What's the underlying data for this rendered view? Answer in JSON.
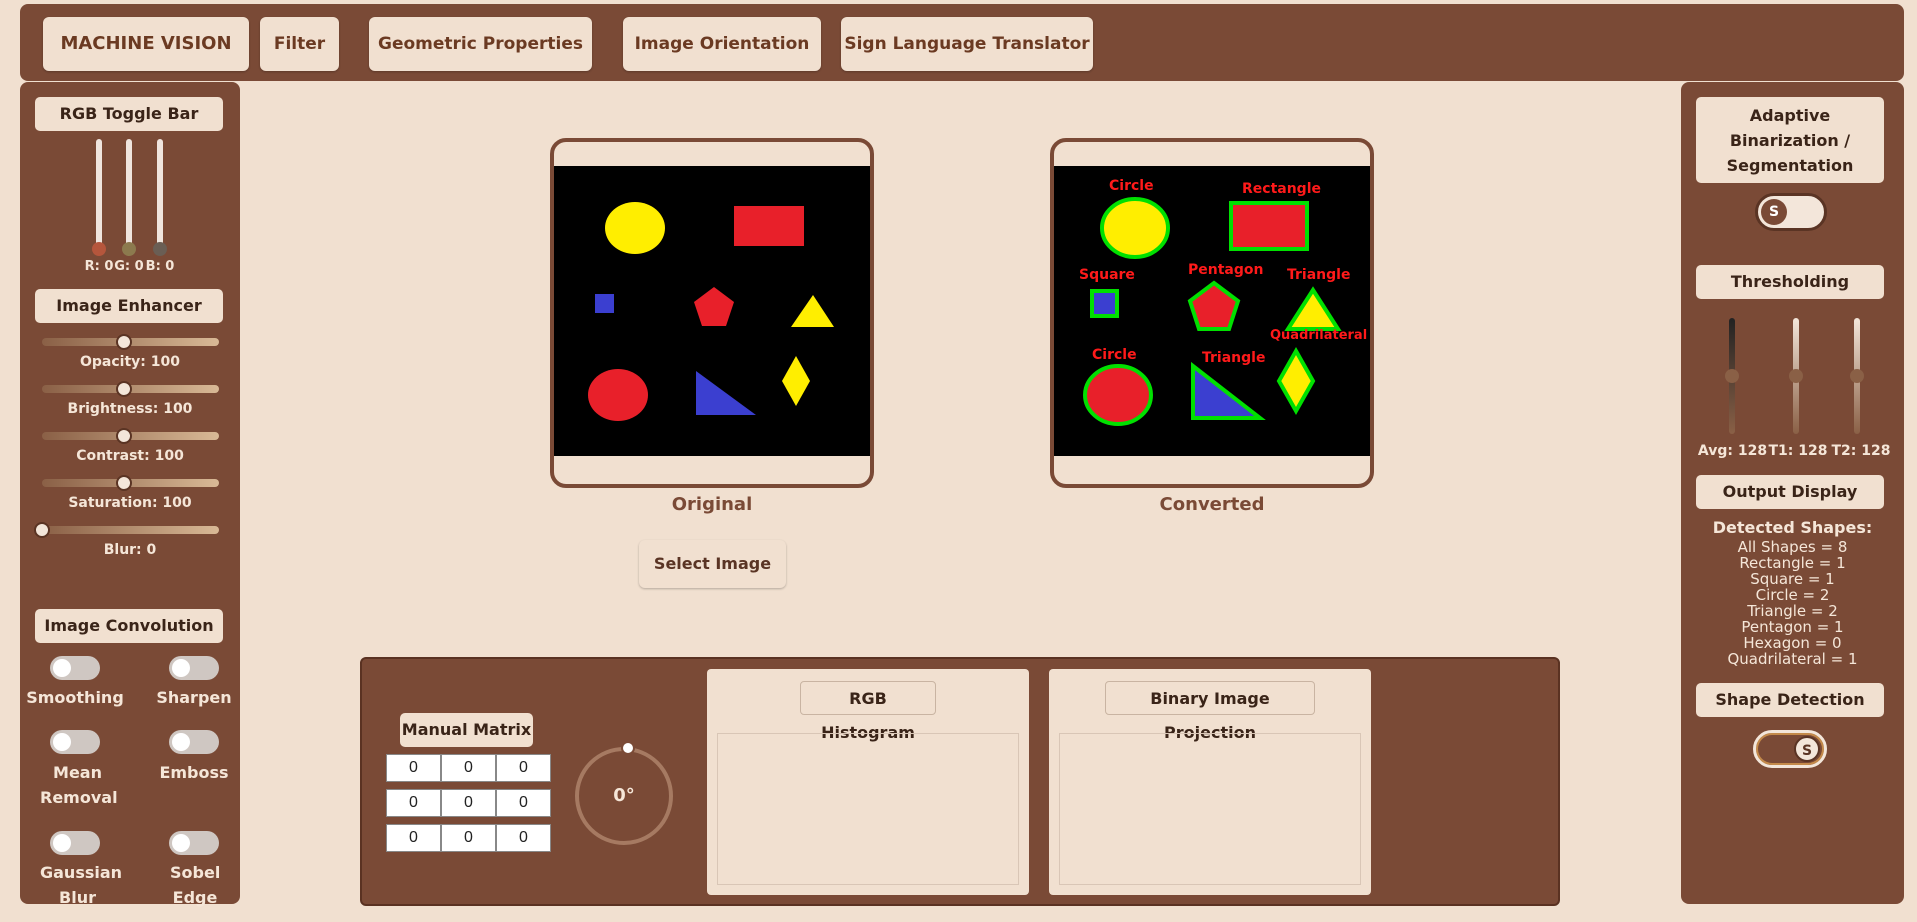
{
  "nav": {
    "brand": "MACHINE VISION",
    "items": [
      "Filter",
      "Geometric Properties",
      "Image Orientation",
      "Sign Language Translator"
    ]
  },
  "left": {
    "rgb_title": "RGB Toggle Bar",
    "rgb_values": {
      "r": "R: 0",
      "g": "G: 0",
      "b": "B: 0"
    },
    "rgb_colors": {
      "r": "#b5563c",
      "g": "#8c7a4e",
      "b": "#6a5e54"
    },
    "enhancer_title": "Image Enhancer",
    "enhancer": [
      {
        "label": "Opacity: 100",
        "value": 0.5
      },
      {
        "label": "Brightness: 100",
        "value": 0.5
      },
      {
        "label": "Contrast: 100",
        "value": 0.5
      },
      {
        "label": "Saturation: 100",
        "value": 0.5
      },
      {
        "label": "Blur: 0",
        "value": 0.0
      }
    ],
    "convolution_title": "Image Convolution",
    "filters": [
      {
        "label": "Smoothing"
      },
      {
        "label": "Sharpen"
      },
      {
        "label": "Mean Removal"
      },
      {
        "label": "Emboss"
      },
      {
        "label": "Gaussian Blur"
      },
      {
        "label": "Sobel Edge"
      }
    ]
  },
  "main": {
    "original_caption": "Original",
    "converted_caption": "Converted",
    "select_button": "Select Image",
    "shape_labels": [
      "Circle",
      "Rectangle",
      "Square",
      "Pentagon",
      "Triangle",
      "Quadrilateral",
      "Circle",
      "Triangle"
    ]
  },
  "bottom": {
    "matrix_title": "Manual Matrix",
    "matrix": [
      [
        "0",
        "0",
        "0"
      ],
      [
        "0",
        "0",
        "0"
      ],
      [
        "0",
        "0",
        "0"
      ]
    ],
    "rotation": "0°",
    "histogram_title": "RGB Histogram",
    "projection_title": "Binary Image Projection"
  },
  "right": {
    "adaptive_title": "Adaptive Binarization / Segmentation",
    "adaptive_toggle": "S",
    "threshold_title": "Thresholding",
    "thresholds": {
      "avg": "Avg: 128",
      "t1": "T1: 128",
      "t2": "T2: 128"
    },
    "output_title": "Output Display",
    "detected_heading": "Detected Shapes:",
    "detected": [
      "All Shapes = 8",
      "Rectangle = 1",
      "Square = 1",
      "Circle = 2",
      "Triangle = 2",
      "Pentagon = 1",
      "Hexagon = 0",
      "Quadrilateral = 1"
    ],
    "shape_detection_title": "Shape Detection",
    "shape_toggle": "S"
  },
  "colors": {
    "brown": "#7a4a36",
    "cream": "#f1e0d0",
    "detect_green": "#00e000",
    "label_red": "#ff1a1a"
  }
}
